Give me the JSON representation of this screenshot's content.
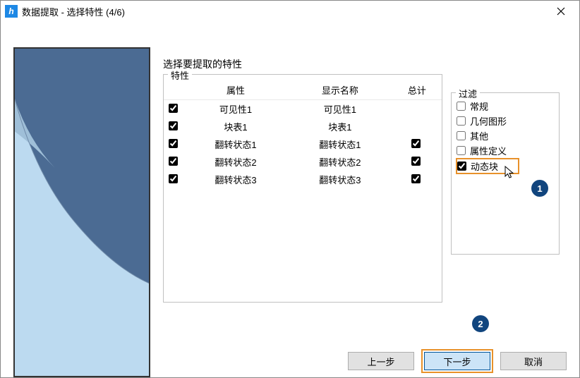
{
  "window": {
    "title": "数据提取 - 选择特性 (4/6)"
  },
  "instruction": "选择要提取的特性",
  "props_group": {
    "label": "特性",
    "columns": {
      "c1": "属性",
      "c2": "显示名称",
      "c3": "总计"
    },
    "rows": [
      {
        "checked": true,
        "attr": "可见性1",
        "display": "可见性1",
        "total": null
      },
      {
        "checked": true,
        "attr": "块表1",
        "display": "块表1",
        "total": null
      },
      {
        "checked": true,
        "attr": "翻转状态1",
        "display": "翻转状态1",
        "total": true
      },
      {
        "checked": true,
        "attr": "翻转状态2",
        "display": "翻转状态2",
        "total": true
      },
      {
        "checked": true,
        "attr": "翻转状态3",
        "display": "翻转状态3",
        "total": true
      }
    ]
  },
  "filter_group": {
    "label": "过滤",
    "items": [
      {
        "label": "常规",
        "checked": false,
        "highlight": false
      },
      {
        "label": "几何图形",
        "checked": false,
        "highlight": false
      },
      {
        "label": "其他",
        "checked": false,
        "highlight": false
      },
      {
        "label": "属性定义",
        "checked": false,
        "highlight": false
      },
      {
        "label": "动态块",
        "checked": true,
        "highlight": true
      }
    ]
  },
  "callouts": {
    "one": "1",
    "two": "2"
  },
  "buttons": {
    "prev": "上一步",
    "next": "下一步",
    "cancel": "取消"
  }
}
